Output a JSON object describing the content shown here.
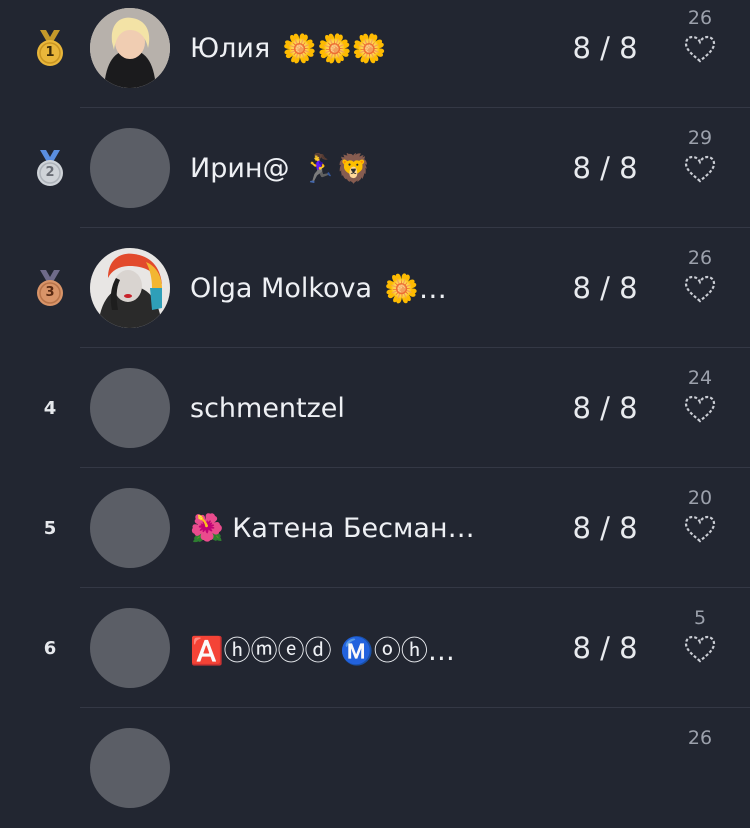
{
  "leaderboard": [
    {
      "rank": "1",
      "medal": "gold",
      "medal_color": "#e9b63a",
      "ribbon_color": "#c59a2a",
      "name": "Юлия",
      "suffix": "🌼🌼🌼",
      "score": "8 / 8",
      "likes": "26",
      "avatar": "photo-woman-blonde"
    },
    {
      "rank": "2",
      "medal": "silver",
      "medal_color": "#cfd3d8",
      "ribbon_color": "#5a8ee0",
      "name": "Ирин@",
      "suffix": "🏃‍♀️🦁",
      "score": "8 / 8",
      "likes": "29",
      "avatar": "placeholder"
    },
    {
      "rank": "3",
      "medal": "bronze",
      "medal_color": "#d99468",
      "ribbon_color": "#6f6b8a",
      "name": "Olga Molkova",
      "suffix": "🌼…",
      "score": "8 / 8",
      "likes": "26",
      "avatar": "photo-woman-artistic"
    },
    {
      "rank": "4",
      "medal": "",
      "name": "schmentzel",
      "suffix": "",
      "score": "8 / 8",
      "likes": "24",
      "avatar": "placeholder"
    },
    {
      "rank": "5",
      "medal": "",
      "name": "🌺 Катена Бесман…",
      "suffix": "",
      "score": "8 / 8",
      "likes": "20",
      "avatar": "placeholder"
    },
    {
      "rank": "6",
      "medal": "",
      "name": "🅰️ⓗⓜⓔⓓ Ⓜ️ⓞⓗ…",
      "suffix": "",
      "score": "8 / 8",
      "likes": "5",
      "avatar": "placeholder"
    },
    {
      "rank": "",
      "medal": "",
      "name": "",
      "suffix": "",
      "score": "",
      "likes": "26",
      "avatar": "placeholder"
    }
  ],
  "colors": {
    "background": "#222631",
    "divider": "#343845",
    "avatar_placeholder": "#5b5e66",
    "heart_outline": "#c9ccd3"
  },
  "icons": {
    "like": "heart-outline-icon"
  }
}
